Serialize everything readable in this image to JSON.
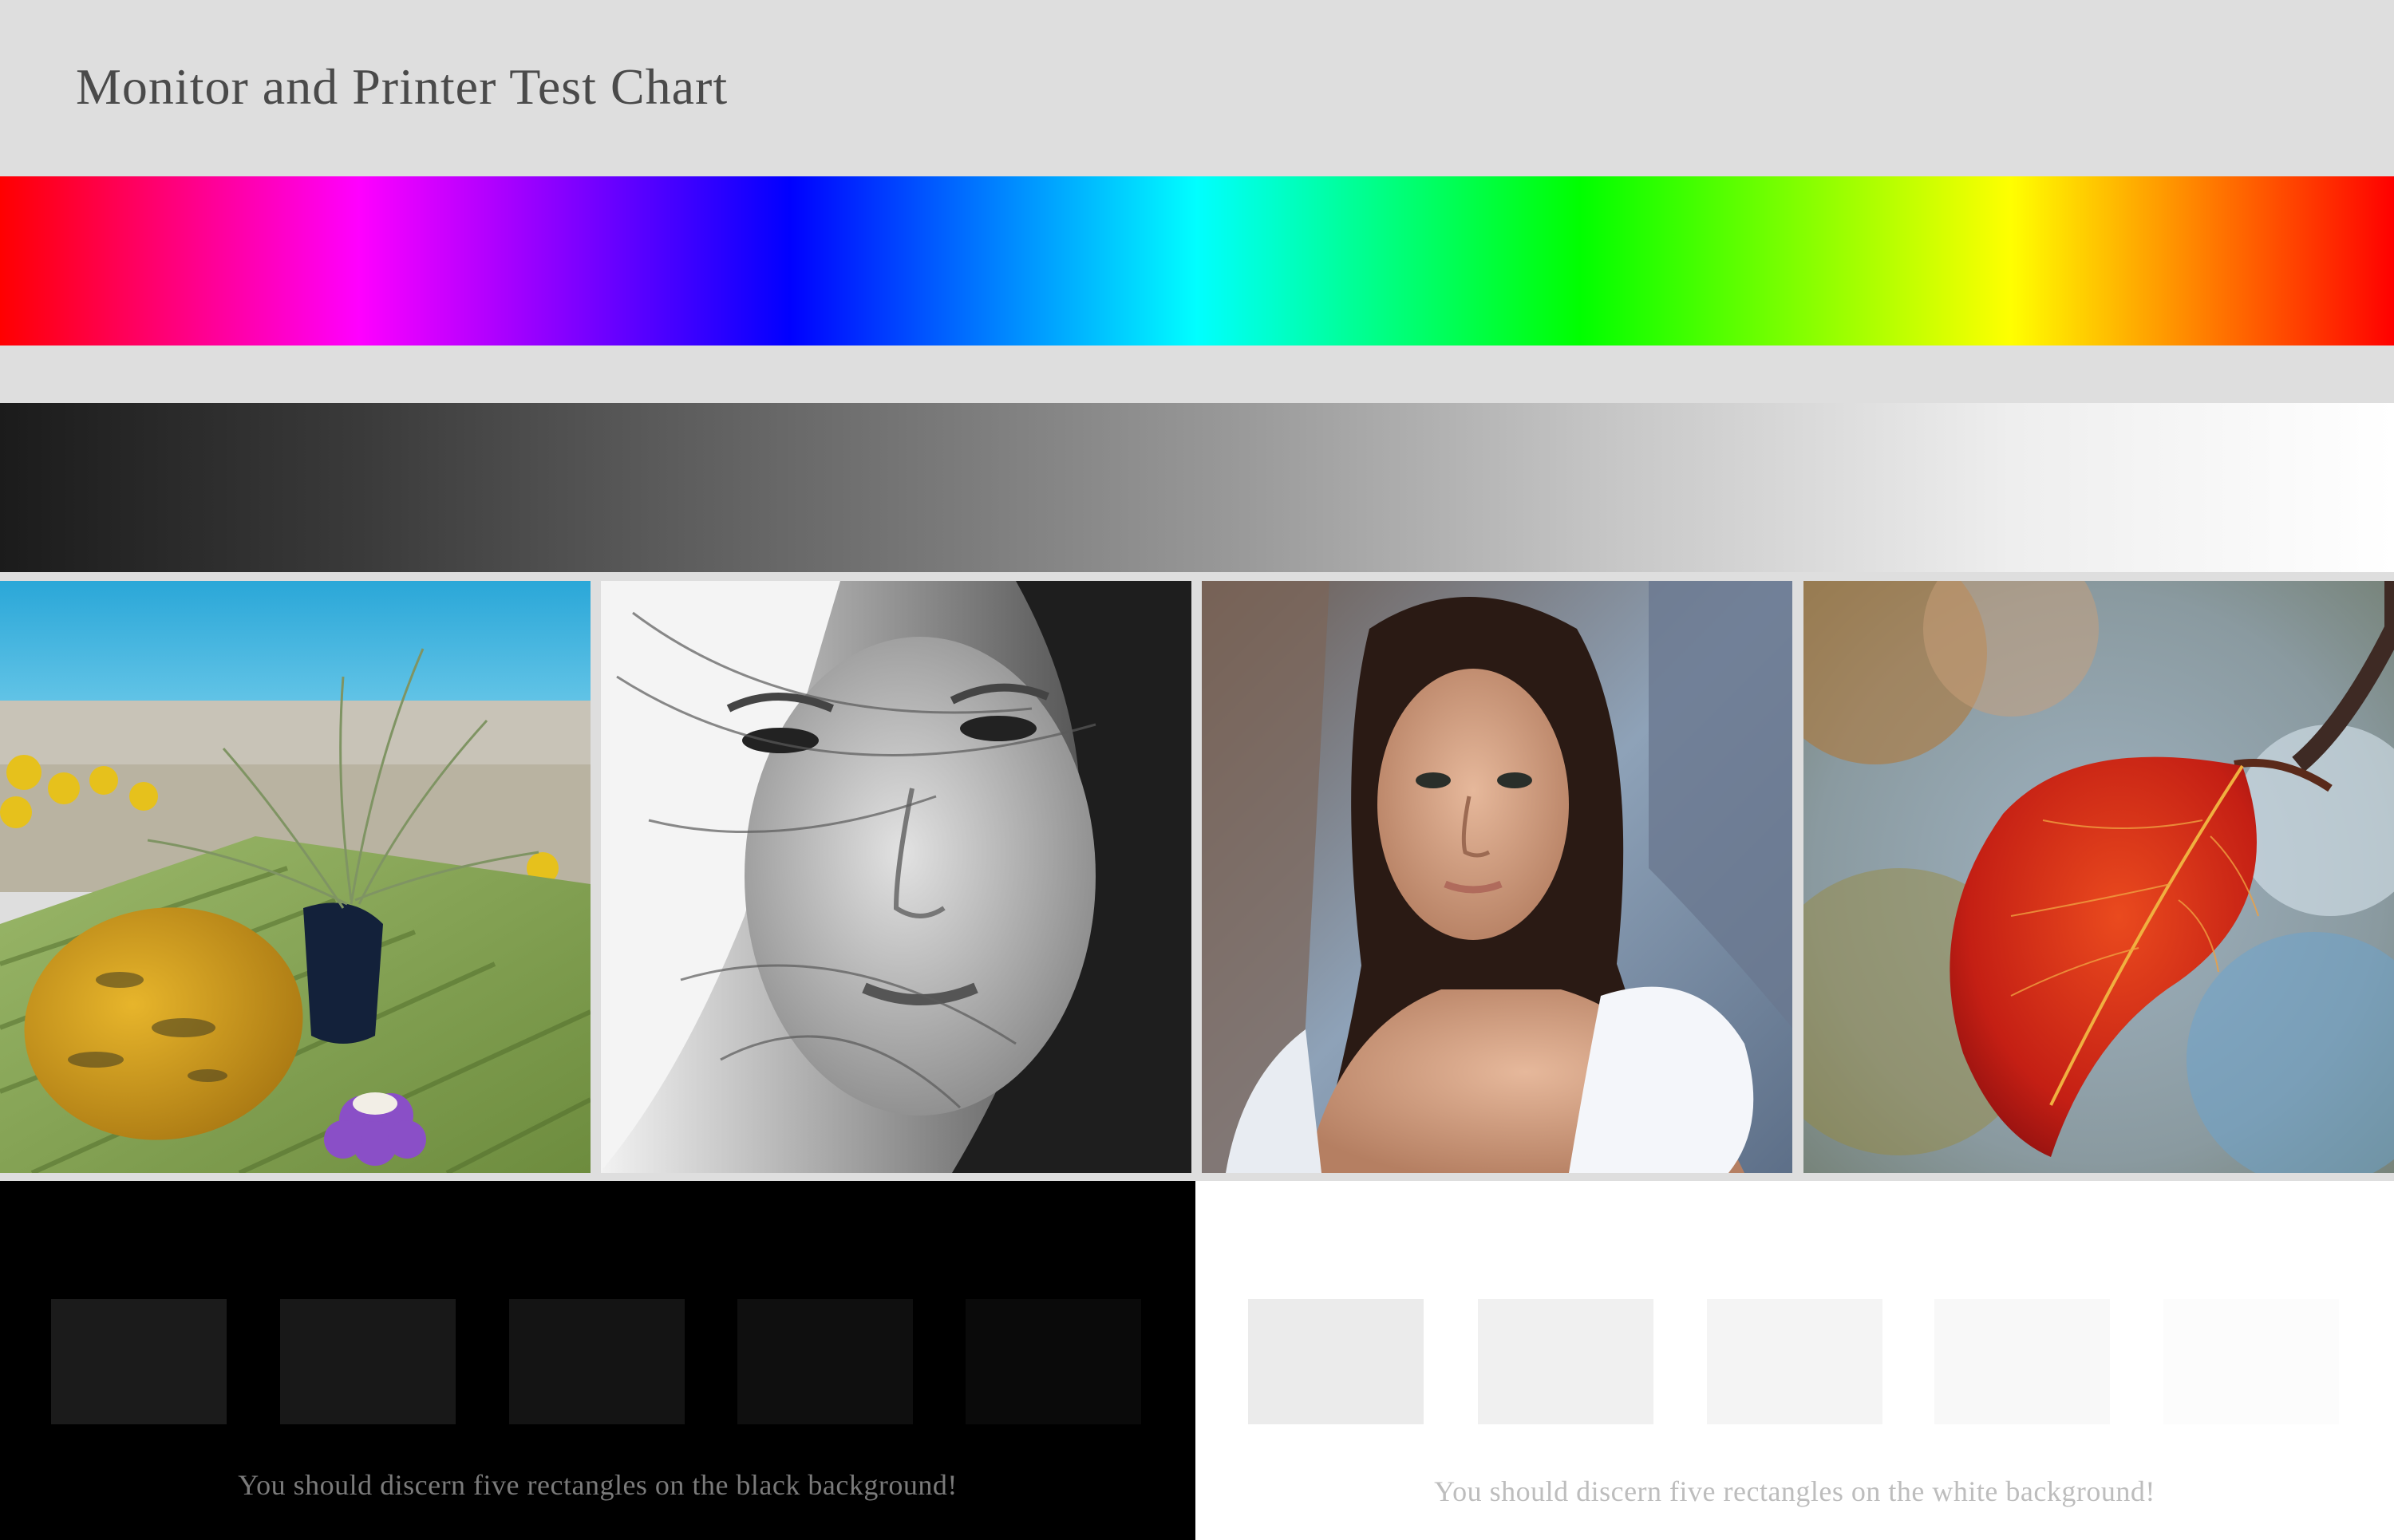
{
  "header": {
    "title": "Monitor and Printer Test Chart"
  },
  "spectrum": {
    "colors": [
      "#ff0000",
      "#ff00ff",
      "#0000ff",
      "#00ffff",
      "#00ff00",
      "#ffff00",
      "#ff0000"
    ]
  },
  "gray_ramp": {
    "from": "#1b1b1b",
    "to": "#ffffff"
  },
  "photos": [
    {
      "subject": "melon-and-flowers-on-table-icon"
    },
    {
      "subject": "black-and-white-portrait-icon"
    },
    {
      "subject": "color-portrait-icon"
    },
    {
      "subject": "red-leaf-icon"
    }
  ],
  "black_test": {
    "background": "#000000",
    "patch_colors": [
      "#1b1b1b",
      "#181818",
      "#141414",
      "#0f0f0f",
      "#0a0a0a"
    ],
    "caption": "You should discern five rectangles on the black background!"
  },
  "white_test": {
    "background": "#ffffff",
    "patch_colors": [
      "#ebebeb",
      "#f0f0f0",
      "#f4f4f4",
      "#f8f8f8",
      "#fcfcfc"
    ],
    "caption": "You should discern five rectangles on the white background!"
  }
}
